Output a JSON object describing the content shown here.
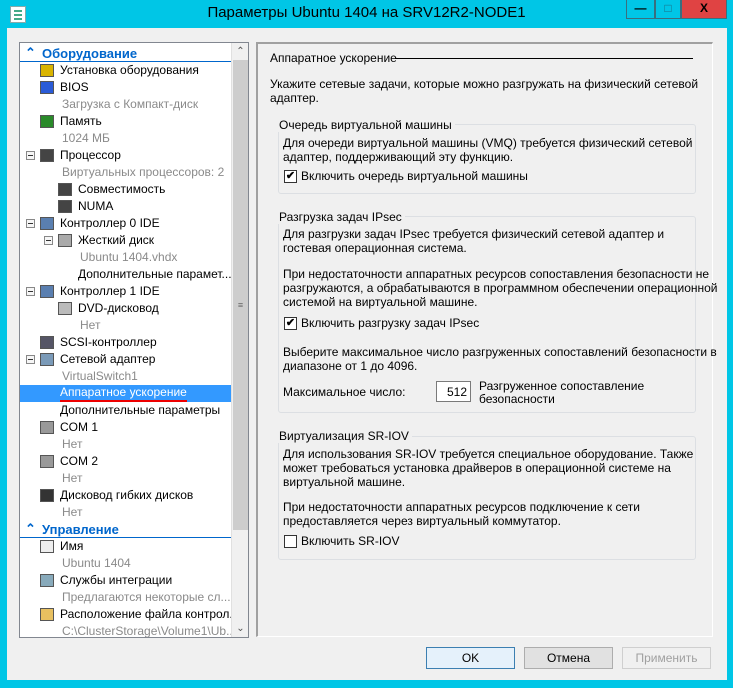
{
  "window": {
    "title": "Параметры Ubuntu 1404 на SRV12R2-NODE1",
    "minimize": "—",
    "maximize": "□",
    "close": "X"
  },
  "tree": [
    {
      "label": "Оборудование",
      "kind": "head",
      "icon": "collapse-section-icon",
      "level": 0
    },
    {
      "label": "Установка оборудования",
      "kind": "item",
      "icon": "add-hardware-icon",
      "level": 1
    },
    {
      "label": "BIOS",
      "kind": "item",
      "icon": "bios-icon",
      "level": 1
    },
    {
      "label": "Загрузка с Компакт-диск",
      "kind": "sub",
      "level": 1
    },
    {
      "label": "Память",
      "kind": "item",
      "icon": "memory-icon",
      "level": 1
    },
    {
      "label": "1024 МБ",
      "kind": "sub",
      "level": 1
    },
    {
      "label": "Процессор",
      "kind": "item",
      "icon": "processor-icon",
      "level": 1,
      "expand": true
    },
    {
      "label": "Виртуальных процессоров: 2",
      "kind": "sub",
      "level": 1
    },
    {
      "label": "Совместимость",
      "kind": "item",
      "icon": "processor-icon",
      "level": 2
    },
    {
      "label": "NUMA",
      "kind": "item",
      "icon": "processor-icon",
      "level": 2
    },
    {
      "label": "Контроллер 0 IDE",
      "kind": "item",
      "icon": "ide-controller-icon",
      "level": 1,
      "expand": true
    },
    {
      "label": "Жесткий диск",
      "kind": "item",
      "icon": "hard-disk-icon",
      "level": 2,
      "expand": true
    },
    {
      "label": "Ubuntu 1404.vhdx",
      "kind": "sub",
      "level": 2
    },
    {
      "label": "Дополнительные парамет...",
      "kind": "item",
      "level": 2
    },
    {
      "label": "Контроллер 1 IDE",
      "kind": "item",
      "icon": "ide-controller-icon",
      "level": 1,
      "expand": true
    },
    {
      "label": "DVD-дисковод",
      "kind": "item",
      "icon": "dvd-icon",
      "level": 2
    },
    {
      "label": "Нет",
      "kind": "sub",
      "level": 2
    },
    {
      "label": "SCSI-контроллер",
      "kind": "item",
      "icon": "scsi-icon",
      "level": 1
    },
    {
      "label": "Сетевой адаптер",
      "kind": "item",
      "icon": "network-adapter-icon",
      "level": 1,
      "expand": true
    },
    {
      "label": "VirtualSwitch1",
      "kind": "sub",
      "level": 1
    },
    {
      "label": "Аппаратное ускорение",
      "kind": "item",
      "level": 1,
      "selected": true
    },
    {
      "label": "Дополнительные параметры",
      "kind": "item",
      "level": 1
    },
    {
      "label": "COM 1",
      "kind": "item",
      "icon": "com-port-icon",
      "level": 1
    },
    {
      "label": "Нет",
      "kind": "sub",
      "level": 1
    },
    {
      "label": "COM 2",
      "kind": "item",
      "icon": "com-port-icon",
      "level": 1
    },
    {
      "label": "Нет",
      "kind": "sub",
      "level": 1
    },
    {
      "label": "Дисковод гибких дисков",
      "kind": "item",
      "icon": "floppy-icon",
      "level": 1
    },
    {
      "label": "Нет",
      "kind": "sub",
      "level": 1
    },
    {
      "label": "Управление",
      "kind": "head",
      "icon": "collapse-section-icon",
      "level": 0
    },
    {
      "label": "Имя",
      "kind": "item",
      "icon": "name-icon",
      "level": 1
    },
    {
      "label": "Ubuntu 1404",
      "kind": "sub",
      "level": 1
    },
    {
      "label": "Службы интеграции",
      "kind": "item",
      "icon": "integration-services-icon",
      "level": 1
    },
    {
      "label": "Предлагаются некоторые сл...",
      "kind": "sub",
      "level": 1
    },
    {
      "label": "Расположение файла контрол...",
      "kind": "item",
      "icon": "checkpoint-folder-icon",
      "level": 1
    },
    {
      "label": "C:\\ClusterStorage\\Volume1\\Ub...",
      "kind": "sub",
      "level": 1
    }
  ],
  "panel": {
    "title": "Аппаратное ускорение",
    "intro": [
      "Укажите сетевые задачи, которые можно разгружать на физический сетевой",
      "адаптер."
    ],
    "vmq": {
      "title": "Очередь виртуальной машины",
      "text": [
        "Для очереди виртуальной машины (VMQ) требуется физический сетевой",
        "адаптер, поддерживающий эту функцию."
      ],
      "checkbox": "Включить очередь виртуальной машины",
      "checked": true
    },
    "ipsec": {
      "title": "Разгрузка задач IPsec",
      "text1": [
        "Для разгрузки задач IPsec требуется физический сетевой адаптер и",
        "гостевая операционная система."
      ],
      "text2": [
        "При недостаточности аппаратных ресурсов сопоставления безопасности не",
        "разгружаются, а обрабатываются в программном обеспечении операционной",
        "системой на виртуальной машине."
      ],
      "checkbox": "Включить разгрузку задач IPsec",
      "checked": true,
      "text3": [
        "Выберите максимальное число разгруженных сопоставлений безопасности в",
        "диапазоне от 1 до 4096."
      ],
      "max_label": "Максимальное число:",
      "max_value": "512",
      "unit": [
        "Разгруженное сопоставление",
        "безопасности"
      ]
    },
    "sriov": {
      "title": "Виртуализация SR-IOV",
      "text1": [
        "Для использования SR-IOV требуется специальное оборудование. Также",
        "может требоваться установка драйверов в операционной системе на",
        "виртуальной машине."
      ],
      "text2": [
        "При недостаточности аппаратных ресурсов подключение к сети",
        "предоставляется через виртуальный коммутатор."
      ],
      "checkbox": "Включить SR-IOV",
      "checked": false
    }
  },
  "buttons": {
    "ok": "OK",
    "cancel": "Отмена",
    "apply": "Применить"
  },
  "colors": {
    "frame": "#00c6e6",
    "selection": "#3399ff",
    "close": "#e04343"
  }
}
